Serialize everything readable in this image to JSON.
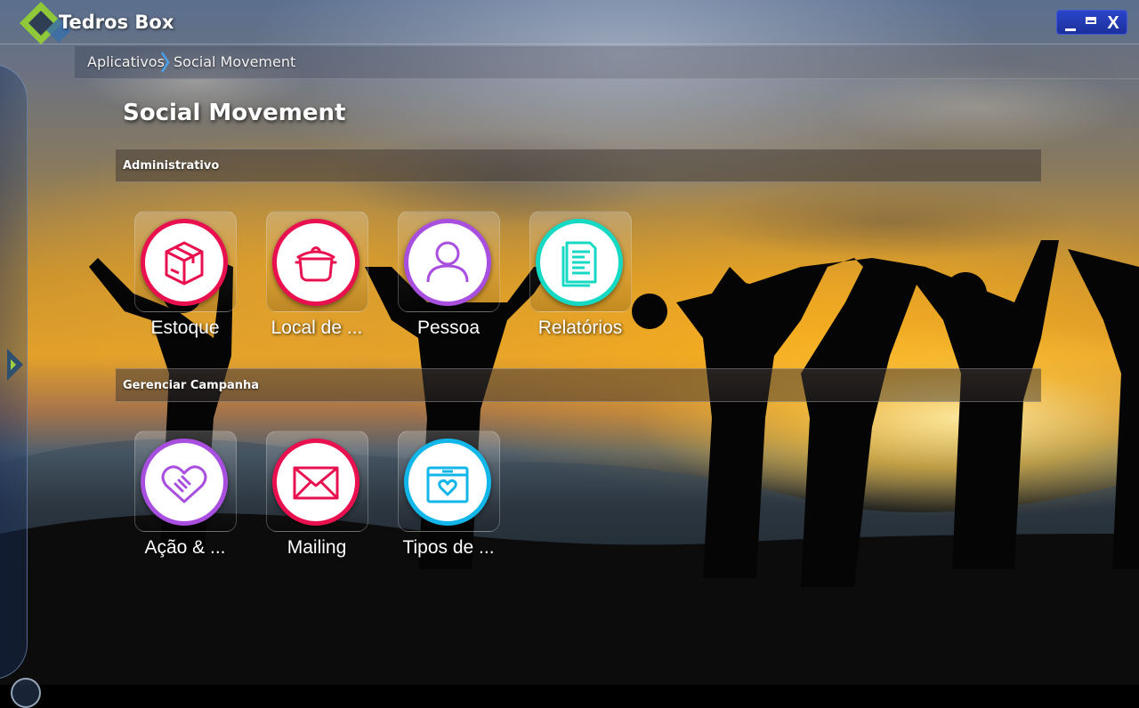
{
  "app": {
    "title": "Tedros Box"
  },
  "breadcrumb": {
    "items": [
      "Aplicativos",
      "Social Movement"
    ]
  },
  "page": {
    "title": "Social Movement"
  },
  "sections": [
    {
      "label": "Administrativo",
      "tiles": [
        {
          "label": "Estoque",
          "icon": "box-icon",
          "color": "#e8104f"
        },
        {
          "label": "Local de ...",
          "icon": "cooking-pot-icon",
          "color": "#e8104f"
        },
        {
          "label": "Pessoa",
          "icon": "person-icon",
          "color": "#a94fe0"
        },
        {
          "label": "Relatórios",
          "icon": "document-icon",
          "color": "#16d9c4"
        }
      ]
    },
    {
      "label": "Gerenciar Campanha",
      "tiles": [
        {
          "label": "Ação & ...",
          "icon": "handshake-heart-icon",
          "color": "#a94fe0"
        },
        {
          "label": "Mailing",
          "icon": "envelope-icon",
          "color": "#e8104f"
        },
        {
          "label": "Tipos de ...",
          "icon": "donation-box-icon",
          "color": "#13b6e8"
        }
      ]
    }
  ],
  "window_controls": {
    "close_label": "X"
  }
}
